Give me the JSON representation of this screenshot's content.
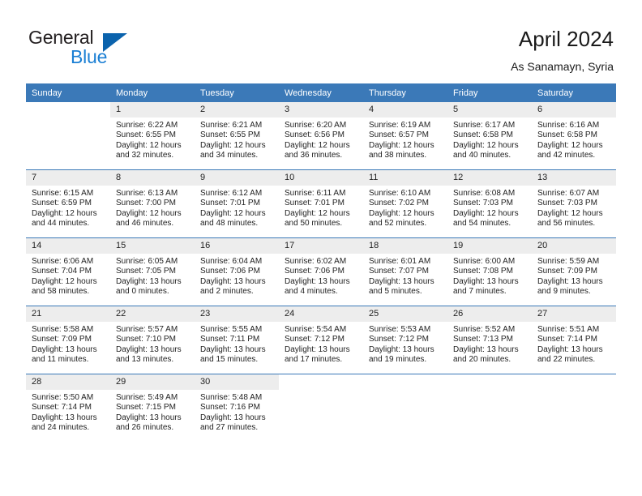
{
  "brand": {
    "name_part1": "General",
    "name_part2": "Blue",
    "logo_icon": "triangle-flag-icon",
    "accent_blue": "#1b7fd4",
    "logo_triangle_blue": "#0b63ad"
  },
  "header": {
    "title": "April 2024",
    "subtitle": "As Sanamayn, Syria",
    "header_row_color": "#3b79b8",
    "daynum_row_color": "#ededed"
  },
  "weekdays": [
    "Sunday",
    "Monday",
    "Tuesday",
    "Wednesday",
    "Thursday",
    "Friday",
    "Saturday"
  ],
  "labels": {
    "sunrise": "Sunrise:",
    "sunset": "Sunset:",
    "daylight": "Daylight:"
  },
  "weeks": [
    [
      {
        "day": "",
        "empty": true
      },
      {
        "day": "1",
        "sunrise": "Sunrise: 6:22 AM",
        "sunset": "Sunset: 6:55 PM",
        "daylight_line1": "Daylight: 12 hours",
        "daylight_line2": "and 32 minutes."
      },
      {
        "day": "2",
        "sunrise": "Sunrise: 6:21 AM",
        "sunset": "Sunset: 6:55 PM",
        "daylight_line1": "Daylight: 12 hours",
        "daylight_line2": "and 34 minutes."
      },
      {
        "day": "3",
        "sunrise": "Sunrise: 6:20 AM",
        "sunset": "Sunset: 6:56 PM",
        "daylight_line1": "Daylight: 12 hours",
        "daylight_line2": "and 36 minutes."
      },
      {
        "day": "4",
        "sunrise": "Sunrise: 6:19 AM",
        "sunset": "Sunset: 6:57 PM",
        "daylight_line1": "Daylight: 12 hours",
        "daylight_line2": "and 38 minutes."
      },
      {
        "day": "5",
        "sunrise": "Sunrise: 6:17 AM",
        "sunset": "Sunset: 6:58 PM",
        "daylight_line1": "Daylight: 12 hours",
        "daylight_line2": "and 40 minutes."
      },
      {
        "day": "6",
        "sunrise": "Sunrise: 6:16 AM",
        "sunset": "Sunset: 6:58 PM",
        "daylight_line1": "Daylight: 12 hours",
        "daylight_line2": "and 42 minutes."
      }
    ],
    [
      {
        "day": "7",
        "sunrise": "Sunrise: 6:15 AM",
        "sunset": "Sunset: 6:59 PM",
        "daylight_line1": "Daylight: 12 hours",
        "daylight_line2": "and 44 minutes."
      },
      {
        "day": "8",
        "sunrise": "Sunrise: 6:13 AM",
        "sunset": "Sunset: 7:00 PM",
        "daylight_line1": "Daylight: 12 hours",
        "daylight_line2": "and 46 minutes."
      },
      {
        "day": "9",
        "sunrise": "Sunrise: 6:12 AM",
        "sunset": "Sunset: 7:01 PM",
        "daylight_line1": "Daylight: 12 hours",
        "daylight_line2": "and 48 minutes."
      },
      {
        "day": "10",
        "sunrise": "Sunrise: 6:11 AM",
        "sunset": "Sunset: 7:01 PM",
        "daylight_line1": "Daylight: 12 hours",
        "daylight_line2": "and 50 minutes."
      },
      {
        "day": "11",
        "sunrise": "Sunrise: 6:10 AM",
        "sunset": "Sunset: 7:02 PM",
        "daylight_line1": "Daylight: 12 hours",
        "daylight_line2": "and 52 minutes."
      },
      {
        "day": "12",
        "sunrise": "Sunrise: 6:08 AM",
        "sunset": "Sunset: 7:03 PM",
        "daylight_line1": "Daylight: 12 hours",
        "daylight_line2": "and 54 minutes."
      },
      {
        "day": "13",
        "sunrise": "Sunrise: 6:07 AM",
        "sunset": "Sunset: 7:03 PM",
        "daylight_line1": "Daylight: 12 hours",
        "daylight_line2": "and 56 minutes."
      }
    ],
    [
      {
        "day": "14",
        "sunrise": "Sunrise: 6:06 AM",
        "sunset": "Sunset: 7:04 PM",
        "daylight_line1": "Daylight: 12 hours",
        "daylight_line2": "and 58 minutes."
      },
      {
        "day": "15",
        "sunrise": "Sunrise: 6:05 AM",
        "sunset": "Sunset: 7:05 PM",
        "daylight_line1": "Daylight: 13 hours",
        "daylight_line2": "and 0 minutes."
      },
      {
        "day": "16",
        "sunrise": "Sunrise: 6:04 AM",
        "sunset": "Sunset: 7:06 PM",
        "daylight_line1": "Daylight: 13 hours",
        "daylight_line2": "and 2 minutes."
      },
      {
        "day": "17",
        "sunrise": "Sunrise: 6:02 AM",
        "sunset": "Sunset: 7:06 PM",
        "daylight_line1": "Daylight: 13 hours",
        "daylight_line2": "and 4 minutes."
      },
      {
        "day": "18",
        "sunrise": "Sunrise: 6:01 AM",
        "sunset": "Sunset: 7:07 PM",
        "daylight_line1": "Daylight: 13 hours",
        "daylight_line2": "and 5 minutes."
      },
      {
        "day": "19",
        "sunrise": "Sunrise: 6:00 AM",
        "sunset": "Sunset: 7:08 PM",
        "daylight_line1": "Daylight: 13 hours",
        "daylight_line2": "and 7 minutes."
      },
      {
        "day": "20",
        "sunrise": "Sunrise: 5:59 AM",
        "sunset": "Sunset: 7:09 PM",
        "daylight_line1": "Daylight: 13 hours",
        "daylight_line2": "and 9 minutes."
      }
    ],
    [
      {
        "day": "21",
        "sunrise": "Sunrise: 5:58 AM",
        "sunset": "Sunset: 7:09 PM",
        "daylight_line1": "Daylight: 13 hours",
        "daylight_line2": "and 11 minutes."
      },
      {
        "day": "22",
        "sunrise": "Sunrise: 5:57 AM",
        "sunset": "Sunset: 7:10 PM",
        "daylight_line1": "Daylight: 13 hours",
        "daylight_line2": "and 13 minutes."
      },
      {
        "day": "23",
        "sunrise": "Sunrise: 5:55 AM",
        "sunset": "Sunset: 7:11 PM",
        "daylight_line1": "Daylight: 13 hours",
        "daylight_line2": "and 15 minutes."
      },
      {
        "day": "24",
        "sunrise": "Sunrise: 5:54 AM",
        "sunset": "Sunset: 7:12 PM",
        "daylight_line1": "Daylight: 13 hours",
        "daylight_line2": "and 17 minutes."
      },
      {
        "day": "25",
        "sunrise": "Sunrise: 5:53 AM",
        "sunset": "Sunset: 7:12 PM",
        "daylight_line1": "Daylight: 13 hours",
        "daylight_line2": "and 19 minutes."
      },
      {
        "day": "26",
        "sunrise": "Sunrise: 5:52 AM",
        "sunset": "Sunset: 7:13 PM",
        "daylight_line1": "Daylight: 13 hours",
        "daylight_line2": "and 20 minutes."
      },
      {
        "day": "27",
        "sunrise": "Sunrise: 5:51 AM",
        "sunset": "Sunset: 7:14 PM",
        "daylight_line1": "Daylight: 13 hours",
        "daylight_line2": "and 22 minutes."
      }
    ],
    [
      {
        "day": "28",
        "sunrise": "Sunrise: 5:50 AM",
        "sunset": "Sunset: 7:14 PM",
        "daylight_line1": "Daylight: 13 hours",
        "daylight_line2": "and 24 minutes."
      },
      {
        "day": "29",
        "sunrise": "Sunrise: 5:49 AM",
        "sunset": "Sunset: 7:15 PM",
        "daylight_line1": "Daylight: 13 hours",
        "daylight_line2": "and 26 minutes."
      },
      {
        "day": "30",
        "sunrise": "Sunrise: 5:48 AM",
        "sunset": "Sunset: 7:16 PM",
        "daylight_line1": "Daylight: 13 hours",
        "daylight_line2": "and 27 minutes."
      },
      {
        "day": "",
        "empty": true
      },
      {
        "day": "",
        "empty": true
      },
      {
        "day": "",
        "empty": true
      },
      {
        "day": "",
        "empty": true
      }
    ]
  ]
}
